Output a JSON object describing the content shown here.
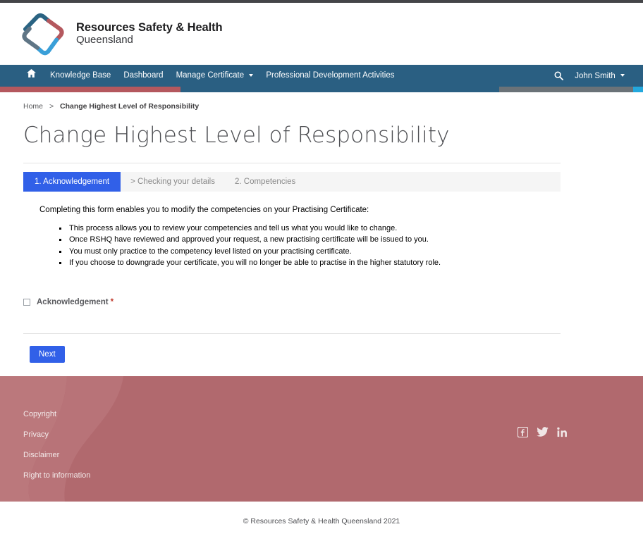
{
  "brand": {
    "logo_icon": "rshq-diamond-logo",
    "line1": "Resources Safety & Health",
    "line2": "Queensland",
    "colors": {
      "teal": "#2a5f82",
      "red": "#b4585e",
      "gray": "#6a7278",
      "light_blue": "#23a8dd",
      "accent_blue": "#3160e8",
      "footer_rose": "#b1696e"
    }
  },
  "nav": {
    "home_icon": "home-icon",
    "items": [
      {
        "label": "Knowledge Base",
        "has_caret": false
      },
      {
        "label": "Dashboard",
        "has_caret": false
      },
      {
        "label": "Manage Certificate",
        "has_caret": true
      },
      {
        "label": "Professional Development Activities",
        "has_caret": false
      }
    ],
    "search_icon": "search-icon",
    "user": "John Smith"
  },
  "breadcrumb": {
    "home": "Home",
    "separator": ">",
    "current": "Change Highest Level of Responsibility"
  },
  "page": {
    "title": "Change Highest Level of Responsibility"
  },
  "tabs": [
    {
      "label": "1. Acknowledgement",
      "active": true
    },
    {
      "label": "> Checking your details",
      "active": false
    },
    {
      "label": "2. Competencies",
      "active": false
    }
  ],
  "form": {
    "intro": "Completing this form enables you to modify the competencies on your Practising Certificate:",
    "bullets": [
      "This process allows you to review your competencies and tell us what you would like to change.",
      "Once RSHQ have reviewed and approved your request, a new practising certificate will be issued to you.",
      "You must only practice to the competency level listed on your practising certificate.",
      "If you choose to downgrade your certificate, you will no longer be able to practise in the higher statutory role."
    ],
    "acknowledgement_label": "Acknowledgement",
    "required_marker": "*",
    "acknowledgement_checked": false,
    "next_label": "Next"
  },
  "footer": {
    "links": [
      "Copyright",
      "Privacy",
      "Disclaimer",
      "Right to information"
    ],
    "social": [
      "facebook-icon",
      "twitter-icon",
      "linkedin-icon"
    ]
  },
  "copyright": {
    "text": "© Resources Safety & Health Queensland 2021"
  }
}
